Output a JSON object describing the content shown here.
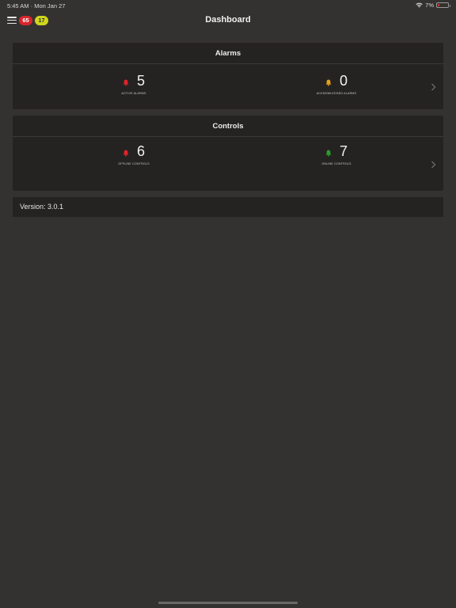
{
  "status": {
    "time": "5:45 AM",
    "date": "Mon Jan 27",
    "battery": "7%",
    "icons": [
      "wifi-icon",
      "battery-icon"
    ]
  },
  "nav": {
    "badge_red": "65",
    "badge_yellow": "17",
    "title": "Dashboard",
    "menu_icon": "hamburger-icon"
  },
  "alarms": {
    "title": "Alarms",
    "active": {
      "value": "5",
      "label": "ACTIVE ALARMS",
      "color": "#e0242a"
    },
    "acknowledged": {
      "value": "0",
      "label": "ACKNOWLEDGED ALARMS",
      "color": "#e8a21c"
    }
  },
  "controls": {
    "title": "Controls",
    "offline": {
      "value": "6",
      "label": "OFFLINE CONTROLS",
      "color": "#e0242a"
    },
    "online": {
      "value": "7",
      "label": "ONLINE CONTROLS",
      "color": "#2aa02a"
    }
  },
  "version": {
    "text": "Version: 3.0.1"
  },
  "colors": {
    "background": "#343231",
    "card": "#242322",
    "badge_red": "#d7262b",
    "badge_yellow": "#cfd61c"
  }
}
